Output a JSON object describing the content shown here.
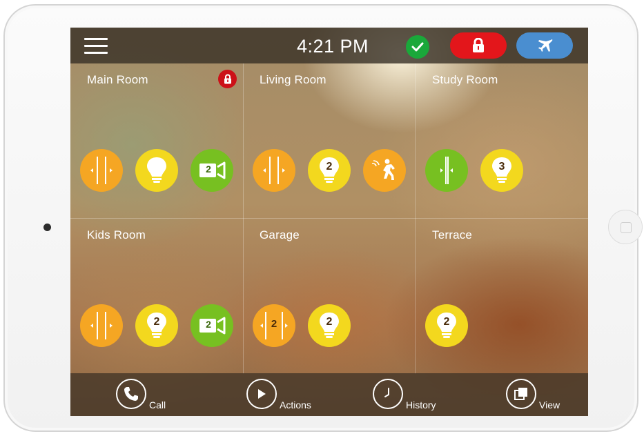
{
  "header": {
    "time": "4:21 PM",
    "status_icon": "check-circle-icon",
    "lock_icon": "padlock-icon",
    "away_icon": "airplane-icon",
    "colors": {
      "status_ok": "#1aa83a",
      "lock": "#e3161b",
      "away": "#4a8ed0"
    }
  },
  "rooms": [
    {
      "name": "Main Room",
      "locked": true,
      "devices": [
        {
          "type": "gate-icon",
          "color": "#f5a623",
          "count": null
        },
        {
          "type": "bulb-icon",
          "color": "#f3d81e",
          "count": null
        },
        {
          "type": "camera-icon",
          "color": "#77c021",
          "count": "2"
        }
      ]
    },
    {
      "name": "Living Room",
      "locked": false,
      "devices": [
        {
          "type": "gate-icon",
          "color": "#f5a623",
          "count": null
        },
        {
          "type": "bulb-icon",
          "color": "#f3d81e",
          "count": "2"
        },
        {
          "type": "motion-sensor-icon",
          "color": "#f5a623",
          "count": null
        }
      ]
    },
    {
      "name": "Study Room",
      "locked": false,
      "devices": [
        {
          "type": "gate-closed-icon",
          "color": "#77c021",
          "count": null
        },
        {
          "type": "bulb-icon",
          "color": "#f3d81e",
          "count": "3"
        }
      ]
    },
    {
      "name": "Kids Room",
      "locked": false,
      "devices": [
        {
          "type": "gate-icon",
          "color": "#f5a623",
          "count": null
        },
        {
          "type": "bulb-icon",
          "color": "#f3d81e",
          "count": "2"
        },
        {
          "type": "camera-icon",
          "color": "#77c021",
          "count": "2"
        }
      ]
    },
    {
      "name": "Garage",
      "locked": false,
      "devices": [
        {
          "type": "gate-icon",
          "color": "#f5a623",
          "count": "2"
        },
        {
          "type": "bulb-icon",
          "color": "#f3d81e",
          "count": "2"
        }
      ]
    },
    {
      "name": "Terrace",
      "locked": false,
      "devices": [
        {
          "type": "bulb-icon",
          "color": "#f3d81e",
          "count": "2"
        }
      ]
    }
  ],
  "bottom_nav": [
    {
      "label": "Call",
      "icon": "phone-icon"
    },
    {
      "label": "Actions",
      "icon": "play-icon"
    },
    {
      "label": "History",
      "icon": "clock-icon"
    },
    {
      "label": "View",
      "icon": "layers-icon"
    }
  ]
}
